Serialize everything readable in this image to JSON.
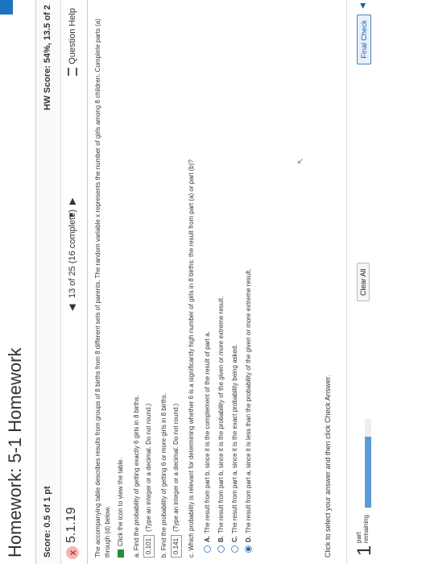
{
  "header": {
    "title": "Homework: 5-1 Homework"
  },
  "scorebar": {
    "score": "Score: 0.5 of 1 pt",
    "hw_score": "HW Score: 54%, 13.5 of 2"
  },
  "question": {
    "number": "5.1.19",
    "status_icon": "x",
    "nav_prev": "◀",
    "nav_text": "13 of 25 (16 complete)",
    "nav_drop": "▼",
    "nav_next": "▶",
    "help": "Question Help"
  },
  "content": {
    "intro": "The accompanying table describes results from groups of 8 births from 8 different sets of parents. The random variable x represents the number of girls among 8 children. Complete parts (a) through (d) below.",
    "table_link": "Click the icon to view the table.",
    "part_a": "a. Find the probability of getting exactly 6 girls in 8 births.",
    "answer_a": "0.101",
    "hint_a": "(Type an integer or a decimal. Do not round.)",
    "part_b": "b. Find the probability of getting 6 or more girls in 8 births.",
    "answer_b": "0.141",
    "hint_b": "(Type an integer or a decimal. Do not round.)",
    "part_c": "c. Which probability is relevant for determining whether 6 is a significantly high number of girls in 8 births: the result from part (a) or part (b)?",
    "options": [
      {
        "letter": "A.",
        "text": "The result from part b, since it is the complement of the result of part a.",
        "selected": false
      },
      {
        "letter": "B.",
        "text": "The result from part b, since it is the probability of the given or more extreme result.",
        "selected": false
      },
      {
        "letter": "C.",
        "text": "The result from part a, since it is the exact probability being asked.",
        "selected": false
      },
      {
        "letter": "D.",
        "text": "The result from part a, since it is less than the probability of the given or more extreme result.",
        "selected": true
      }
    ]
  },
  "footer": {
    "instruction": "Click to select your answer and then click Check Answer.",
    "parts_num": "1",
    "parts_label_1": "part",
    "parts_label_2": "remaining",
    "progress": 0.8,
    "clear_all": "Clear All",
    "final_check": "Final Check",
    "final_arrow": "◀"
  }
}
